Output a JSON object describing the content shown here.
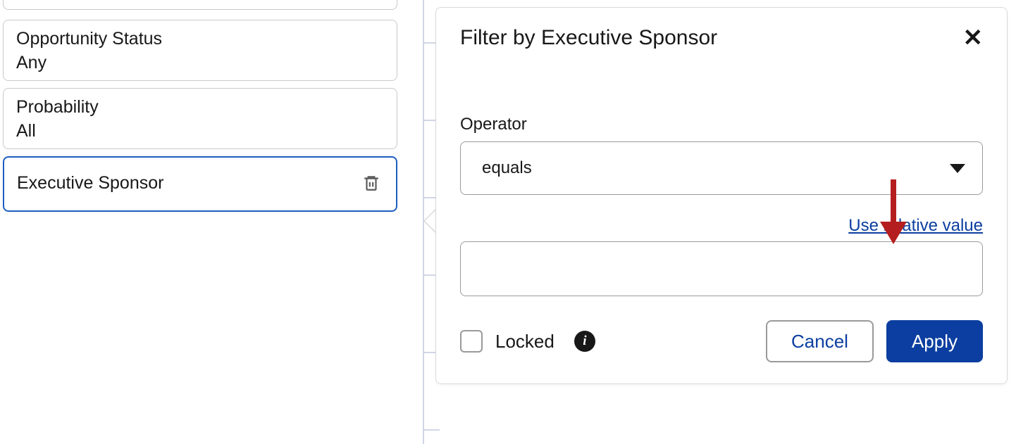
{
  "sidebar": {
    "filters": [
      {
        "title": "Opportunity Status",
        "value": "Any"
      },
      {
        "title": "Probability",
        "value": "All"
      },
      {
        "title": "Executive Sponsor",
        "value": ""
      }
    ]
  },
  "popover": {
    "title": "Filter by Executive Sponsor",
    "operator_label": "Operator",
    "operator_value": "equals",
    "use_relative_label": "Use relative value",
    "value_input": "",
    "locked_label": "Locked",
    "locked_checked": false,
    "cancel_label": "Cancel",
    "apply_label": "Apply"
  },
  "colors": {
    "accent": "#0b3ea0",
    "annotation": "#b51e1e"
  }
}
